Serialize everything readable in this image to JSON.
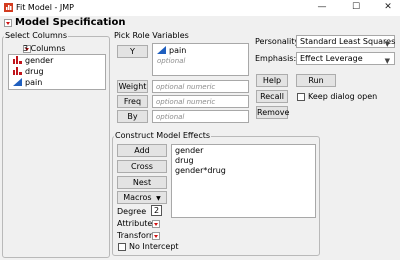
{
  "window": {
    "title": "Fit Model - JMP",
    "minimize_glyph": "—",
    "maximize_glyph": "☐",
    "close_glyph": "✕"
  },
  "header": {
    "title": "Model Specification"
  },
  "select_columns": {
    "label": "Select Columns",
    "count_label": "3 Columns",
    "columns": [
      {
        "name": "gender",
        "icon": "nominal-column-icon"
      },
      {
        "name": "drug",
        "icon": "nominal-column-icon"
      },
      {
        "name": "pain",
        "icon": "continuous-column-icon"
      }
    ]
  },
  "pick_roles": {
    "label": "Pick Role Variables",
    "y_button": "Y",
    "y_value": "pain",
    "y_placeholder": "optional",
    "weight_button": "Weight",
    "weight_placeholder": "optional numeric",
    "freq_button": "Freq",
    "freq_placeholder": "optional numeric",
    "by_button": "By",
    "by_placeholder": "optional"
  },
  "personality": {
    "label": "Personality:",
    "value": "Standard Least Squares"
  },
  "emphasis": {
    "label": "Emphasis:",
    "value": "Effect Leverage"
  },
  "actions": {
    "help": "Help",
    "run": "Run",
    "recall": "Recall",
    "remove": "Remove",
    "keep_open": "Keep dialog open"
  },
  "construct": {
    "label": "Construct Model Effects",
    "add": "Add",
    "cross": "Cross",
    "nest": "Nest",
    "macros": "Macros",
    "degree_label": "Degree",
    "degree_value": "2",
    "attributes_label": "Attributes",
    "transform_label": "Transform",
    "no_intercept": "No Intercept",
    "effects": [
      "gender",
      "drug",
      "gender*drug"
    ]
  },
  "colors": {
    "nominal_icon": "#c0141b",
    "continuous_icon": "#1f5fbf",
    "disclosure_red": "#d01010"
  }
}
